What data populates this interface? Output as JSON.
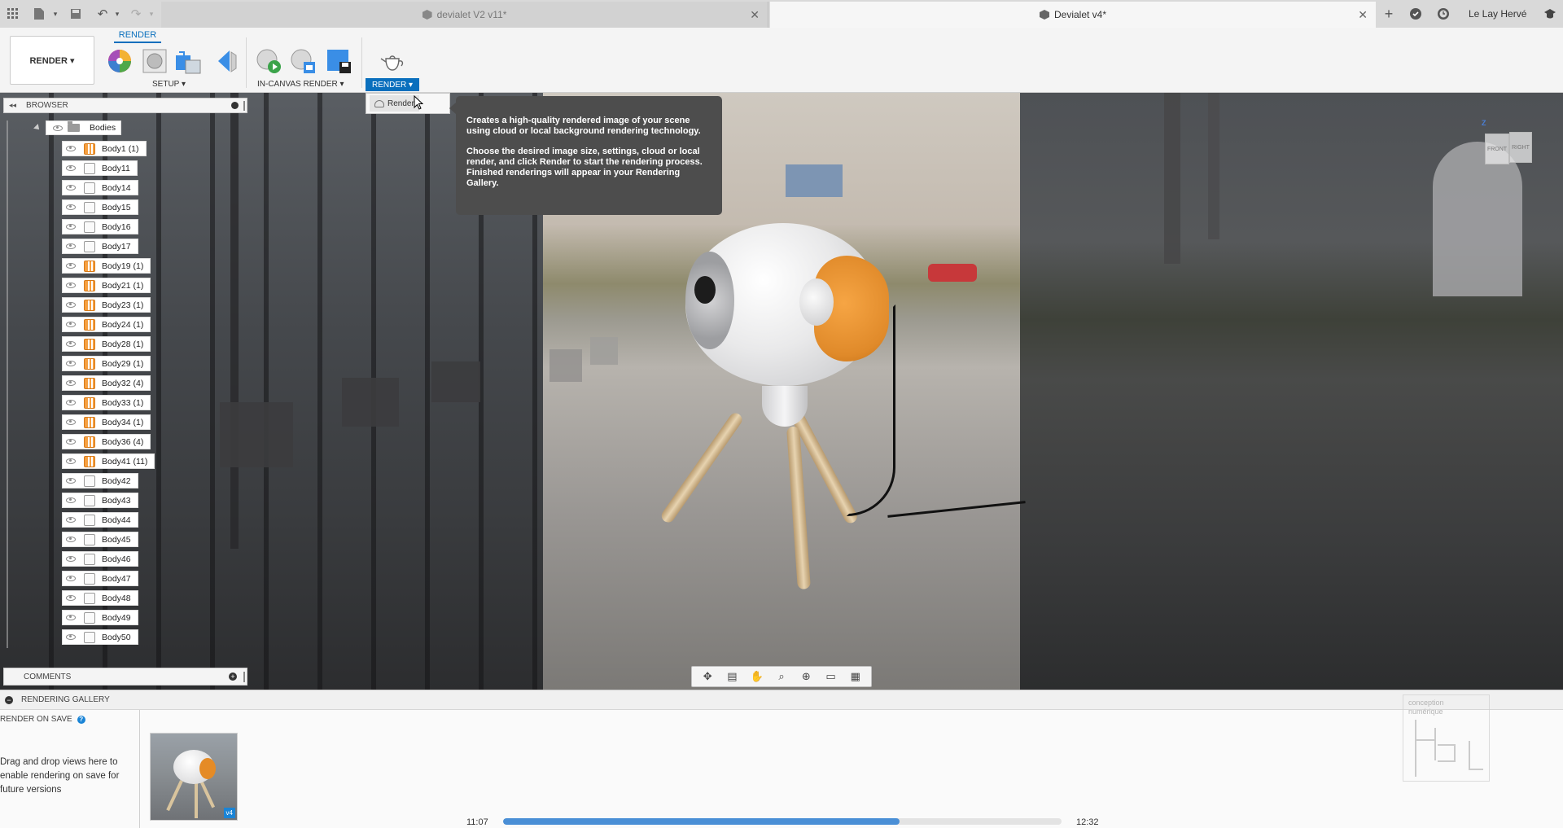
{
  "titlebar": {
    "tabs": [
      {
        "label": "devialet V2 v11*",
        "active": false
      },
      {
        "label": "Devialet v4*",
        "active": true
      }
    ],
    "user": "Le Lay Hervé",
    "icons": [
      "grid-icon",
      "file-icon",
      "save-icon",
      "undo-icon",
      "redo-icon",
      "add-tab-icon",
      "job-status-icon",
      "clock-icon",
      "help-icon"
    ]
  },
  "ribbon": {
    "workspace": "RENDER ▾",
    "active_tab": "RENDER",
    "groups": {
      "setup": "SETUP ▾",
      "in_canvas": "IN-CANVAS RENDER ▾",
      "render": "RENDER ▾"
    },
    "accent": "#0a6fbd"
  },
  "dropdown": {
    "item": "Render"
  },
  "tooltip": {
    "p1": "Creates a high-quality rendered image of your scene using cloud or local background rendering technology.",
    "p2": "Choose the desired image size, settings, cloud or local render, and click Render to start the rendering process. Finished renderings will appear in your Rendering Gallery."
  },
  "browser": {
    "title": "BROWSER",
    "root": "Bodies",
    "bodies": [
      {
        "label": "Body1 (1)",
        "component": true
      },
      {
        "label": "Body11",
        "component": false
      },
      {
        "label": "Body14",
        "component": false
      },
      {
        "label": "Body15",
        "component": false
      },
      {
        "label": "Body16",
        "component": false
      },
      {
        "label": "Body17",
        "component": false
      },
      {
        "label": "Body19 (1)",
        "component": true
      },
      {
        "label": "Body21 (1)",
        "component": true
      },
      {
        "label": "Body23 (1)",
        "component": true
      },
      {
        "label": "Body24 (1)",
        "component": true
      },
      {
        "label": "Body28 (1)",
        "component": true
      },
      {
        "label": "Body29 (1)",
        "component": true
      },
      {
        "label": "Body32 (4)",
        "component": true
      },
      {
        "label": "Body33 (1)",
        "component": true
      },
      {
        "label": "Body34 (1)",
        "component": true
      },
      {
        "label": "Body36 (4)",
        "component": true
      },
      {
        "label": "Body41 (11)",
        "component": true
      },
      {
        "label": "Body42",
        "component": false
      },
      {
        "label": "Body43",
        "component": false
      },
      {
        "label": "Body44",
        "component": false
      },
      {
        "label": "Body45",
        "component": false
      },
      {
        "label": "Body46",
        "component": false
      },
      {
        "label": "Body47",
        "component": false
      },
      {
        "label": "Body48",
        "component": false
      },
      {
        "label": "Body49",
        "component": false
      },
      {
        "label": "Body50",
        "component": false
      }
    ]
  },
  "comments": {
    "title": "COMMENTS"
  },
  "viewcube": {
    "front": "FRONT",
    "right": "RIGHT",
    "axis": "Z"
  },
  "navbar": {
    "icons": [
      "orbit-icon",
      "look-at-icon",
      "pan-icon",
      "zoom-icon",
      "fit-icon",
      "display-settings-icon",
      "grid-settings-icon"
    ]
  },
  "gallery": {
    "title": "RENDERING GALLERY",
    "render_on_save": "RENDER ON SAVE",
    "drag_text": "Drag and drop views here to enable rendering on save for future versions",
    "thumb_badge": "v4"
  },
  "progress": {
    "start": "11:07",
    "end": "12:32",
    "fraction": 0.71
  },
  "watermark": {
    "line1": "conception",
    "line2": "numérique"
  }
}
